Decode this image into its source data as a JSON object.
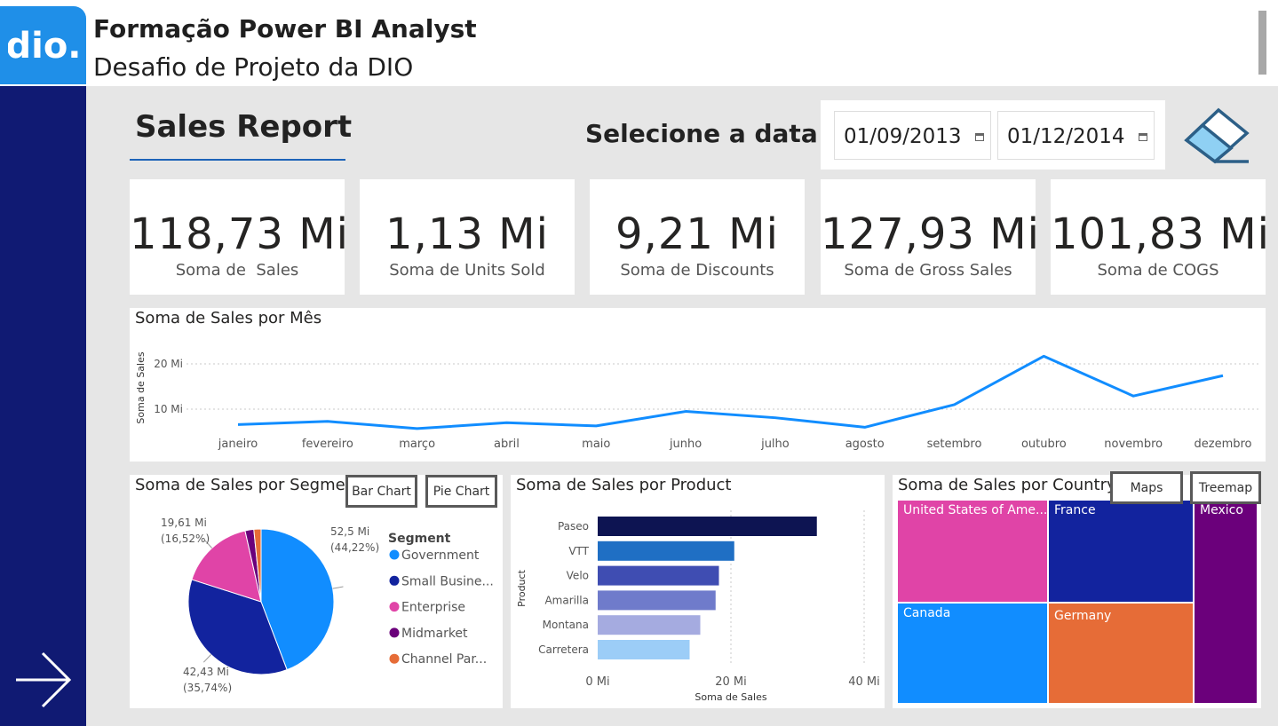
{
  "header": {
    "title": "Formação Power BI Analyst",
    "subtitle": "Desafio de Projeto da DIO",
    "logo_text": "dio."
  },
  "report": {
    "title": "Sales Report",
    "date_prompt": "Selecione a data",
    "start_date": "01/09/2013",
    "end_date": "01/12/2014"
  },
  "kpis": [
    {
      "value": "118,73 Mi",
      "label": "Soma de  Sales"
    },
    {
      "value": "1,13 Mi",
      "label": "Soma de Units Sold"
    },
    {
      "value": "9,21 Mi",
      "label": "Soma de Discounts"
    },
    {
      "value": "127,93 Mi",
      "label": "Soma de Gross Sales"
    },
    {
      "value": "101,83 Mi",
      "label": "Soma de COGS"
    }
  ],
  "colors": {
    "accent": "#118dff",
    "sidebar": "#101a73",
    "line": "#118dff"
  },
  "chart_data": [
    {
      "type": "line",
      "title": "Soma de Sales por Mês",
      "ylabel": "Soma de Sales",
      "yticks": [
        "10 Mi",
        "20 Mi"
      ],
      "ylim": [
        0,
        25
      ],
      "categories": [
        "janeiro",
        "fevereiro",
        "março",
        "abril",
        "maio",
        "junho",
        "julho",
        "agosto",
        "setembro",
        "outubro",
        "novembro",
        "dezembro"
      ],
      "values": [
        6.6,
        7.3,
        5.7,
        7.0,
        6.3,
        9.5,
        8.1,
        6.0,
        11.0,
        21.7,
        12.9,
        17.4
      ]
    },
    {
      "type": "pie",
      "title": "Soma de Sales por Segment",
      "legend_title": "Segment",
      "slices": [
        {
          "name": "Government",
          "legend": "Government",
          "value": 52.5,
          "label": "52,5 Mi",
          "pct": "(44,22%)",
          "color": "#118dff"
        },
        {
          "name": "Small Business",
          "legend": "Small Busine...",
          "value": 42.43,
          "label": "42,43 Mi",
          "pct": "(35,74%)",
          "color": "#12239e"
        },
        {
          "name": "Enterprise",
          "legend": "Enterprise",
          "value": 19.61,
          "label": "19,61 Mi",
          "pct": "(16,52%)",
          "color": "#e044a7"
        },
        {
          "name": "Midmarket",
          "legend": "Midmarket",
          "value": 2.3,
          "label": "",
          "pct": "",
          "color": "#6b007b"
        },
        {
          "name": "Channel Partners",
          "legend": "Channel Par...",
          "value": 1.9,
          "label": "",
          "pct": "",
          "color": "#e66c37"
        }
      ]
    },
    {
      "type": "bar",
      "title": "Soma de Sales por Product",
      "xlabel": "Soma de Sales",
      "ylabel": "Product",
      "xticks": [
        "0 Mi",
        "20 Mi",
        "40 Mi"
      ],
      "xlim": [
        0,
        40
      ],
      "categories": [
        "Paseo",
        "VTT",
        "Velo",
        "Amarilla",
        "Montana",
        "Carretera"
      ],
      "values": [
        32.9,
        20.5,
        18.2,
        17.7,
        15.4,
        13.8
      ],
      "colors": [
        "#0d1452",
        "#1f6fc4",
        "#3f4db2",
        "#6f7bcb",
        "#a5abe0",
        "#9ccdf7"
      ]
    },
    {
      "type": "treemap",
      "title": "Soma de Sales por Country",
      "items": [
        {
          "name": "United States of Ame...",
          "color": "#e044a7"
        },
        {
          "name": "France",
          "color": "#12239e"
        },
        {
          "name": "Mexico",
          "color": "#6b007b"
        },
        {
          "name": "Canada",
          "color": "#118dff"
        },
        {
          "name": "Germany",
          "color": "#e66c37"
        }
      ]
    }
  ],
  "toggles": {
    "bar_chart": "Bar Chart",
    "pie_chart": "Pie Chart",
    "maps": "Maps",
    "treemap": "Treemap"
  }
}
